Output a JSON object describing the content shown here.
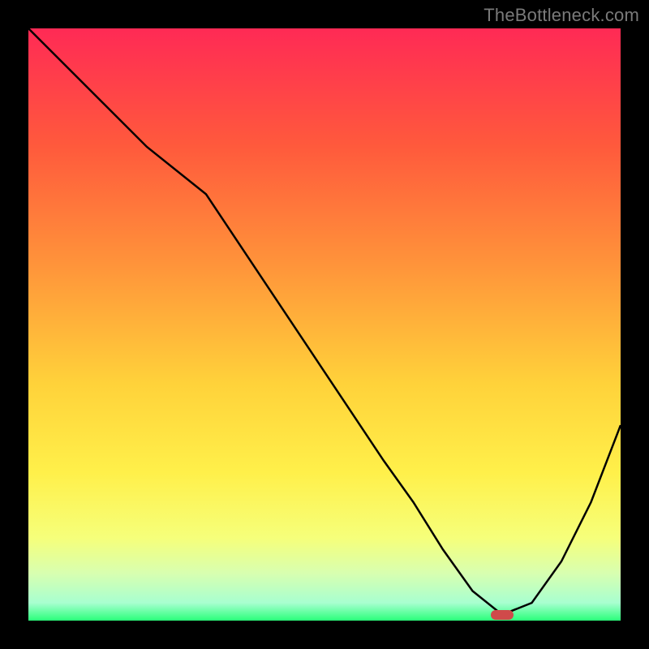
{
  "watermark": "TheBottleneck.com",
  "chart_data": {
    "type": "line",
    "title": "",
    "xlabel": "",
    "ylabel": "",
    "xlim": [
      0,
      100
    ],
    "ylim": [
      0,
      100
    ],
    "series": [
      {
        "name": "bottleneck-curve",
        "x": [
          0,
          10,
          20,
          30,
          40,
          50,
          60,
          65,
          70,
          75,
          80,
          85,
          90,
          95,
          100
        ],
        "y": [
          100,
          90,
          80,
          72,
          57,
          42,
          27,
          20,
          12,
          5,
          1,
          3,
          10,
          20,
          33
        ]
      }
    ],
    "marker": {
      "x": 80,
      "y": 1,
      "label": "optimal-point"
    },
    "gradient_stops": [
      {
        "offset": 0.0,
        "color": "#ff2a55"
      },
      {
        "offset": 0.2,
        "color": "#ff5a3c"
      },
      {
        "offset": 0.4,
        "color": "#ff943a"
      },
      {
        "offset": 0.6,
        "color": "#ffd23a"
      },
      {
        "offset": 0.75,
        "color": "#fff04a"
      },
      {
        "offset": 0.86,
        "color": "#f6ff7a"
      },
      {
        "offset": 0.92,
        "color": "#d8ffb0"
      },
      {
        "offset": 0.97,
        "color": "#a8ffd0"
      },
      {
        "offset": 1.0,
        "color": "#2aff7a"
      }
    ]
  }
}
